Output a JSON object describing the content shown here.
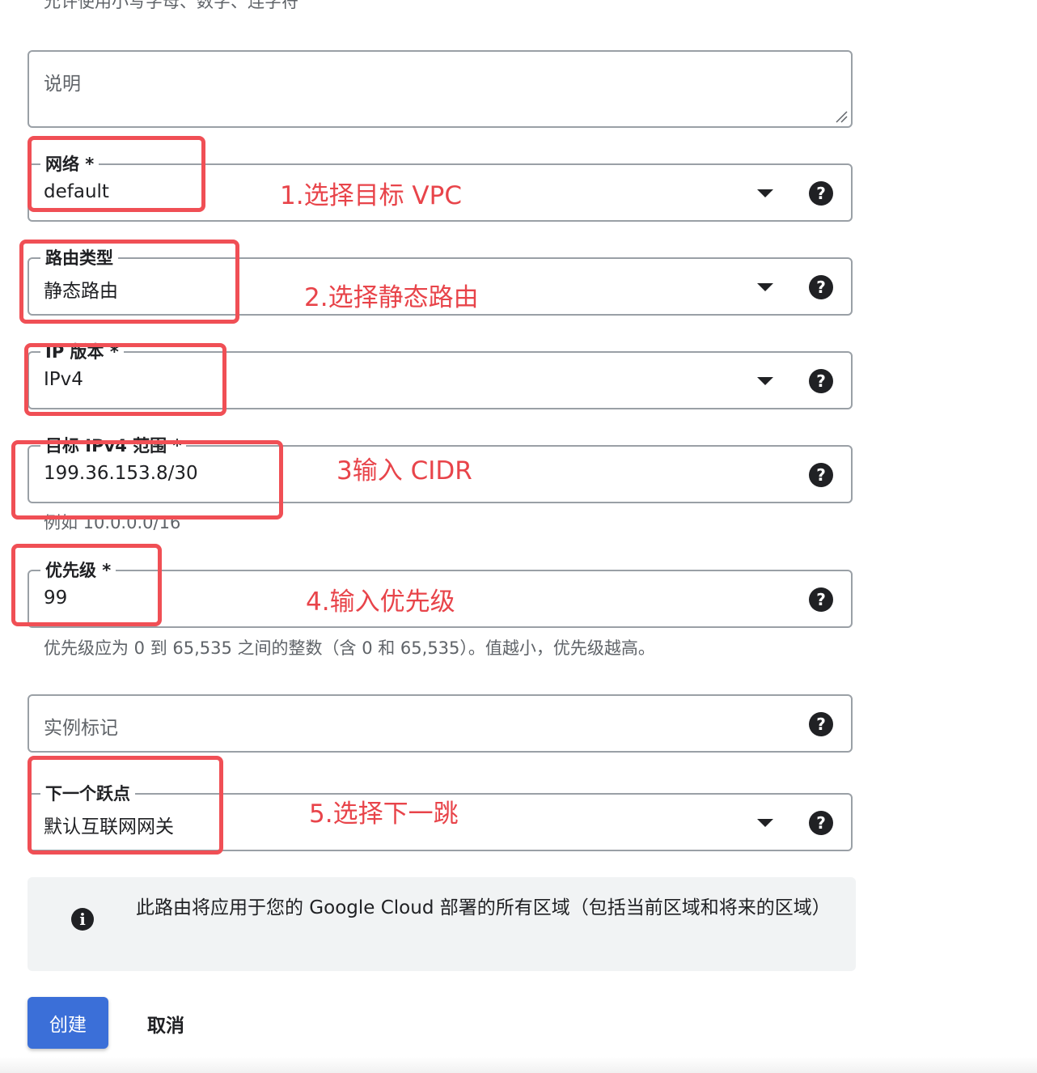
{
  "top_hint": "允许使用小写字母、数字、连字符",
  "description": {
    "placeholder": "说明"
  },
  "network": {
    "label": "网络 *",
    "value": "default"
  },
  "route_type": {
    "label": "路由类型",
    "value": "静态路由"
  },
  "ip_version": {
    "label": "IP 版本 *",
    "value": "IPv4"
  },
  "dest_range": {
    "label": "目标 IPv4 范围 *",
    "value": "199.36.153.8/30",
    "hint": "例如 10.0.0.0/16"
  },
  "priority": {
    "label": "优先级 *",
    "value": "99",
    "hint": "优先级应为 0 到 65,535 之间的整数（含 0 和 65,535）。值越小，优先级越高。"
  },
  "instance_tags": {
    "placeholder": "实例标记"
  },
  "next_hop": {
    "label": "下一个跃点",
    "value": "默认互联网网关"
  },
  "help_glyph": "?",
  "info": {
    "icon_glyph": "i",
    "text": "此路由将应用于您的 Google Cloud 部署的所有区域（包括当前区域和将来的区域）"
  },
  "buttons": {
    "create": "创建",
    "cancel": "取消"
  },
  "annotations": {
    "step1": "1.选择目标 VPC",
    "step2": "2.选择静态路由",
    "step3": "3输入 CIDR",
    "step4": "4.输入优先级",
    "step5": "5.选择下一跳"
  },
  "colors": {
    "annotation": "#f04f55",
    "primary_button": "#3b6fd8",
    "info_background": "#f1f3f4"
  },
  "icons": [
    "help-icon",
    "dropdown-arrow-icon",
    "info-icon",
    "resize-handle-icon"
  ]
}
